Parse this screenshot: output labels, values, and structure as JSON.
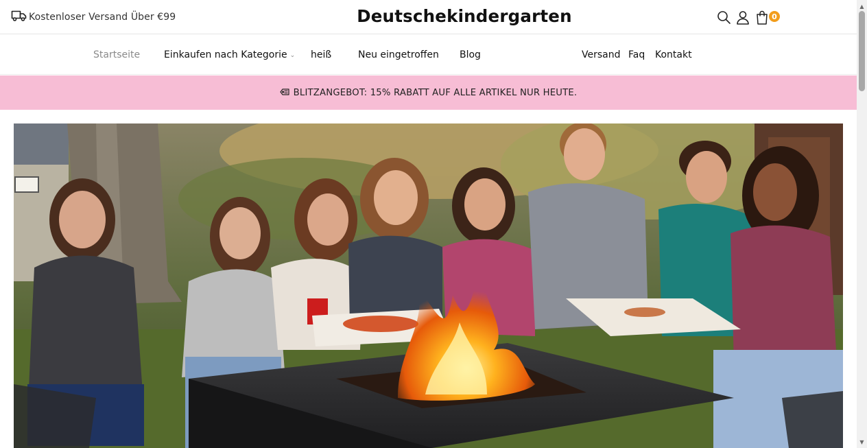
{
  "header": {
    "shipping_text": "Kostenloser Versand Über €99",
    "brand": "Deutschekindergarten",
    "cart_count": "0",
    "icons": [
      "truck-icon",
      "search-icon",
      "user-icon",
      "shopping-bag-icon"
    ]
  },
  "nav": {
    "left": [
      {
        "label": "Startseite",
        "active": true
      },
      {
        "label": "Einkaufen nach Kategorie",
        "dropdown": true
      },
      {
        "label": "heiß"
      },
      {
        "label": "Neu eingetroffen"
      },
      {
        "label": "Blog"
      }
    ],
    "right": [
      {
        "label": "Versand"
      },
      {
        "label": "Faq"
      },
      {
        "label": "Kontakt"
      }
    ]
  },
  "promo": {
    "text": "BLITZANGEBOT: 15% RABATT AUF ALLE ARTIKEL NUR HEUTE.",
    "icon": "tag-icon"
  },
  "hero": {
    "image": "teens-eating-pizza-around-fire-pit-table"
  },
  "colors": {
    "promo_bg": "#f7bdd5",
    "cart_badge": "#f29d1c",
    "nav_active": "#8a8a8a"
  }
}
